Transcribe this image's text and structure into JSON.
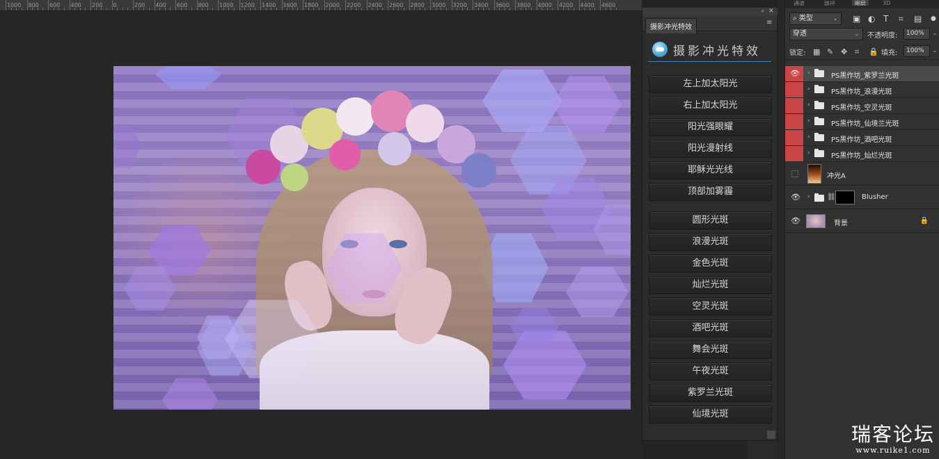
{
  "ruler": {
    "ticks": [
      "1000",
      "800",
      "600",
      "400",
      "200",
      "0",
      "200",
      "400",
      "600",
      "800",
      "1000",
      "1200",
      "1400",
      "1600",
      "1800",
      "2000",
      "2200",
      "2400",
      "2600",
      "2800",
      "3000",
      "3200",
      "3400",
      "3600",
      "3800",
      "4000",
      "4200",
      "4400",
      "4600"
    ]
  },
  "plugin": {
    "tab_label": "摄影冲光特效",
    "title": "摄影冲光特效",
    "buttons_top": [
      "左上加太阳光",
      "右上加太阳光",
      "阳光强眼耀",
      "阳光漫射线",
      "耶稣光光线",
      "顶部加雾霾"
    ],
    "buttons_bottom": [
      "圆形光斑",
      "浪漫光斑",
      "金色光斑",
      "灿烂光斑",
      "空灵光斑",
      "酒吧光斑",
      "舞会光斑",
      "午夜光斑",
      "紫罗兰光斑",
      "仙境光斑"
    ]
  },
  "layers_panel": {
    "tabs": [
      "通道",
      "路径",
      "图层",
      "3D"
    ],
    "filter_label": "类型",
    "blend_mode": "穿透",
    "opacity_label": "不透明度:",
    "opacity_value": "100%",
    "lock_label": "锁定:",
    "fill_label": "填充:",
    "fill_value": "100%",
    "layers": [
      {
        "name": "PS黑作坊_紫罗兰光斑",
        "type": "group",
        "visible": true
      },
      {
        "name": "PS黑作坊_浪漫光斑",
        "type": "group",
        "visible": false
      },
      {
        "name": "PS黑作坊_空灵光斑",
        "type": "group",
        "visible": false
      },
      {
        "name": "PS黑作坊_仙境兰光斑",
        "type": "group",
        "visible": false
      },
      {
        "name": "PS黑作坊_酒吧光斑",
        "type": "group",
        "visible": false
      },
      {
        "name": "PS黑作坊_灿烂光斑",
        "type": "group",
        "visible": false
      }
    ],
    "layer_chongguang": "冲光A",
    "layer_blusher": "Blusher",
    "layer_background": "背景"
  },
  "watermark": {
    "main": "瑞客论坛",
    "sub": "www.ruike1.com"
  },
  "colors": {
    "eye_column": "#c94444",
    "accent_line": "#3a86b8"
  }
}
